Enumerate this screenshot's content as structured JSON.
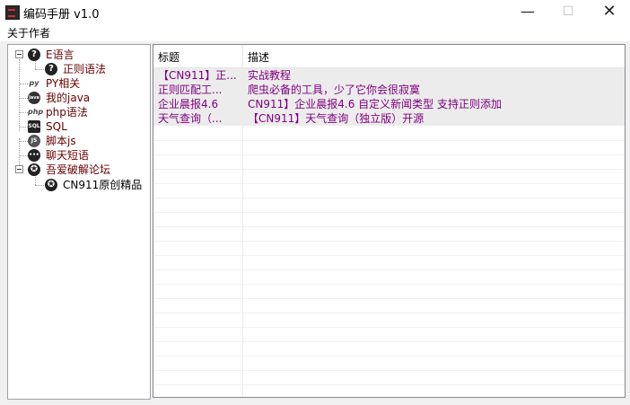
{
  "window": {
    "title": "编码手册 v1.0",
    "minimize": "—",
    "maximize": "☐",
    "close": "✕"
  },
  "menu": {
    "about": "关于作者"
  },
  "tree": [
    {
      "label": "E语言",
      "icon": "question-icon",
      "glyph": "?"
    },
    {
      "label": "正则语法",
      "icon": "question-icon",
      "glyph": "?"
    },
    {
      "label": "PY相关",
      "icon": "python-icon",
      "glyph": "py"
    },
    {
      "label": "我的java",
      "icon": "java-icon",
      "glyph": "Java"
    },
    {
      "label": "php语法",
      "icon": "php-icon",
      "glyph": "php"
    },
    {
      "label": "SQL",
      "icon": "sql-icon",
      "glyph": "SQL"
    },
    {
      "label": "脚本js",
      "icon": "js-icon",
      "glyph": "JS"
    },
    {
      "label": "聊天短语",
      "icon": "chat-icon",
      "glyph": "•••"
    },
    {
      "label": "吾爱破解论坛",
      "icon": "forum-icon",
      "glyph": "✪"
    },
    {
      "label": "CN911原创精品",
      "icon": "forum-icon",
      "glyph": "✪"
    }
  ],
  "list": {
    "headers": [
      "标题",
      "描述"
    ],
    "rows": [
      {
        "title": "【CN911】正...",
        "desc": "实战教程"
      },
      {
        "title": "正则匹配工...",
        "desc": "爬虫必备的工具，少了它你会很寂寞"
      },
      {
        "title": "企业晨报4.6",
        "desc": "CN911】企业晨报4.6 自定义新闻类型 支持正则添加"
      },
      {
        "title": "天气查询（...",
        "desc": "【CN911】天气查询（独立版）开源"
      }
    ]
  }
}
